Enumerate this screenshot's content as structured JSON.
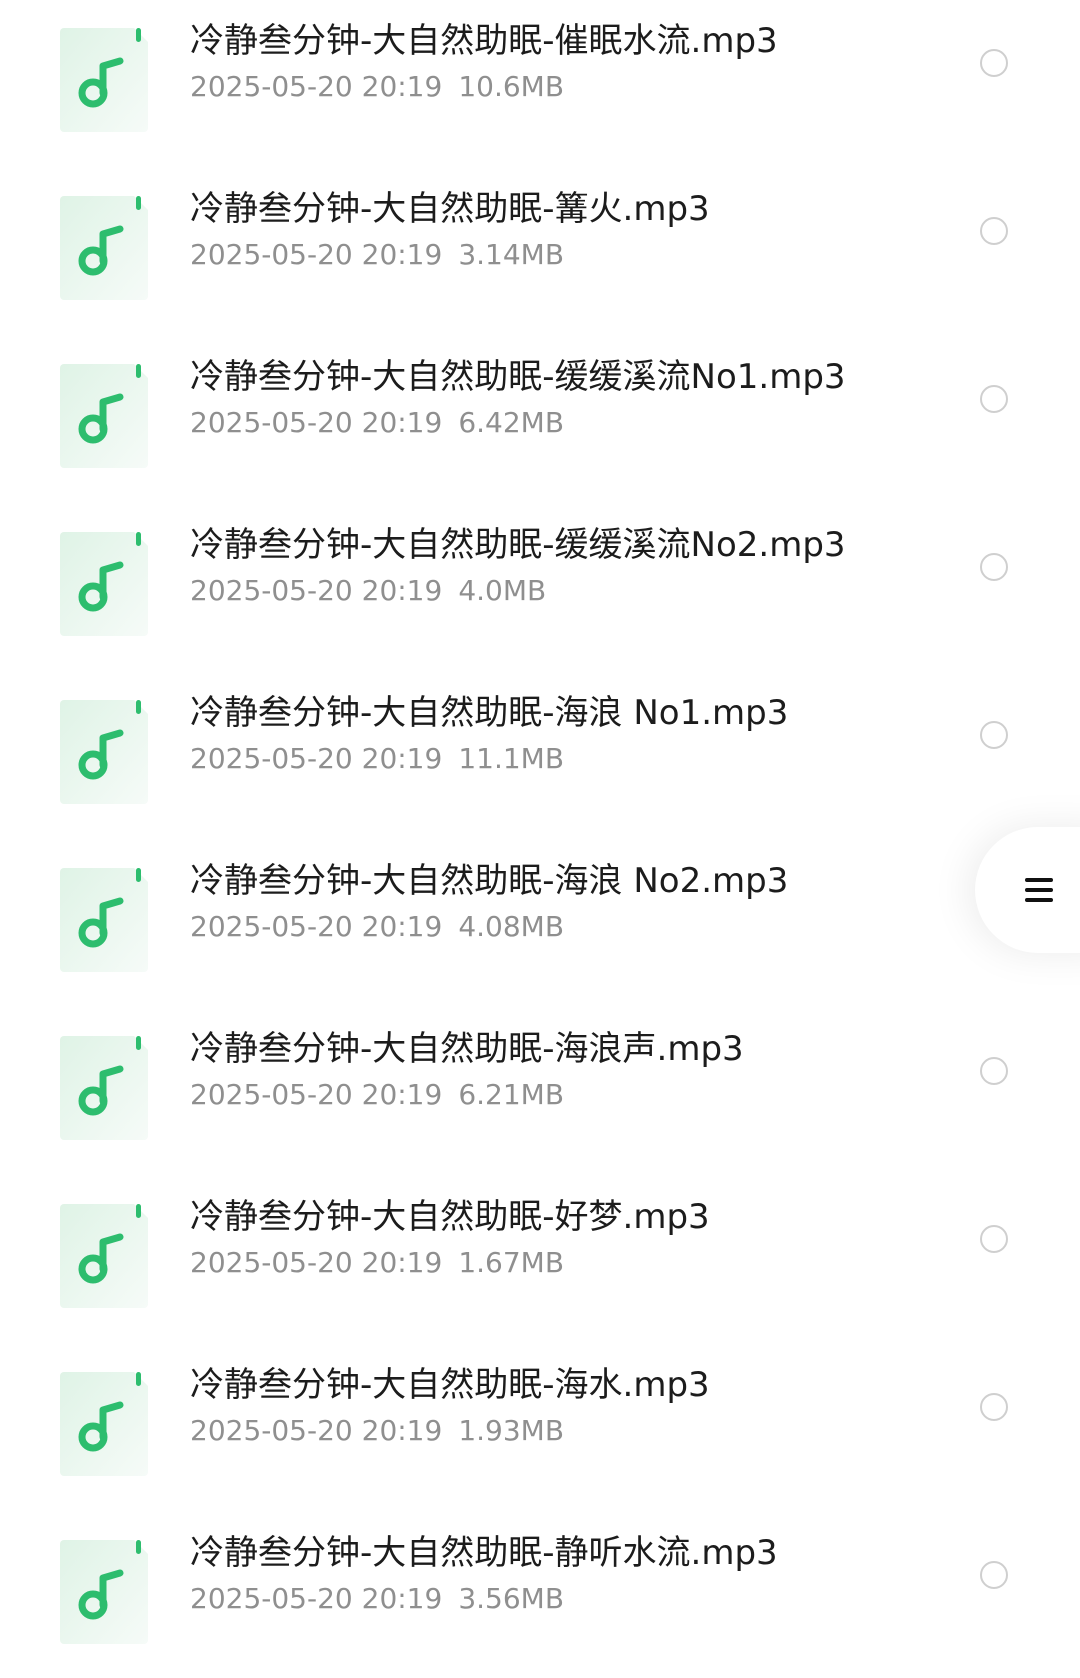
{
  "files": [
    {
      "name": "冷静叁分钟-大自然助眠-催眠水流.mp3",
      "date": "2025-05-20 20:19",
      "size": "10.6MB"
    },
    {
      "name": "冷静叁分钟-大自然助眠-篝火.mp3",
      "date": "2025-05-20 20:19",
      "size": "3.14MB"
    },
    {
      "name": "冷静叁分钟-大自然助眠-缓缓溪流No1.mp3",
      "date": "2025-05-20 20:19",
      "size": "6.42MB"
    },
    {
      "name": "冷静叁分钟-大自然助眠-缓缓溪流No2.mp3",
      "date": "2025-05-20 20:19",
      "size": "4.0MB"
    },
    {
      "name": "冷静叁分钟-大自然助眠-海浪 No1.mp3",
      "date": "2025-05-20 20:19",
      "size": "11.1MB"
    },
    {
      "name": "冷静叁分钟-大自然助眠-海浪 No2.mp3",
      "date": "2025-05-20 20:19",
      "size": "4.08MB"
    },
    {
      "name": "冷静叁分钟-大自然助眠-海浪声.mp3",
      "date": "2025-05-20 20:19",
      "size": "6.21MB"
    },
    {
      "name": "冷静叁分钟-大自然助眠-好梦.mp3",
      "date": "2025-05-20 20:19",
      "size": "1.67MB"
    },
    {
      "name": "冷静叁分钟-大自然助眠-海水.mp3",
      "date": "2025-05-20 20:19",
      "size": "1.93MB"
    },
    {
      "name": "冷静叁分钟-大自然助眠-静听水流.mp3",
      "date": "2025-05-20 20:19",
      "size": "3.56MB"
    }
  ],
  "icons": {
    "file_type": "music-note-icon",
    "side_menu": "menu-icon"
  },
  "colors": {
    "accent": "#2dbd6e",
    "icon_bg": "#e9f7ee",
    "title_text": "#1c1c1c",
    "meta_text": "#8f8f8f",
    "radio_border": "#cfcfcf"
  }
}
